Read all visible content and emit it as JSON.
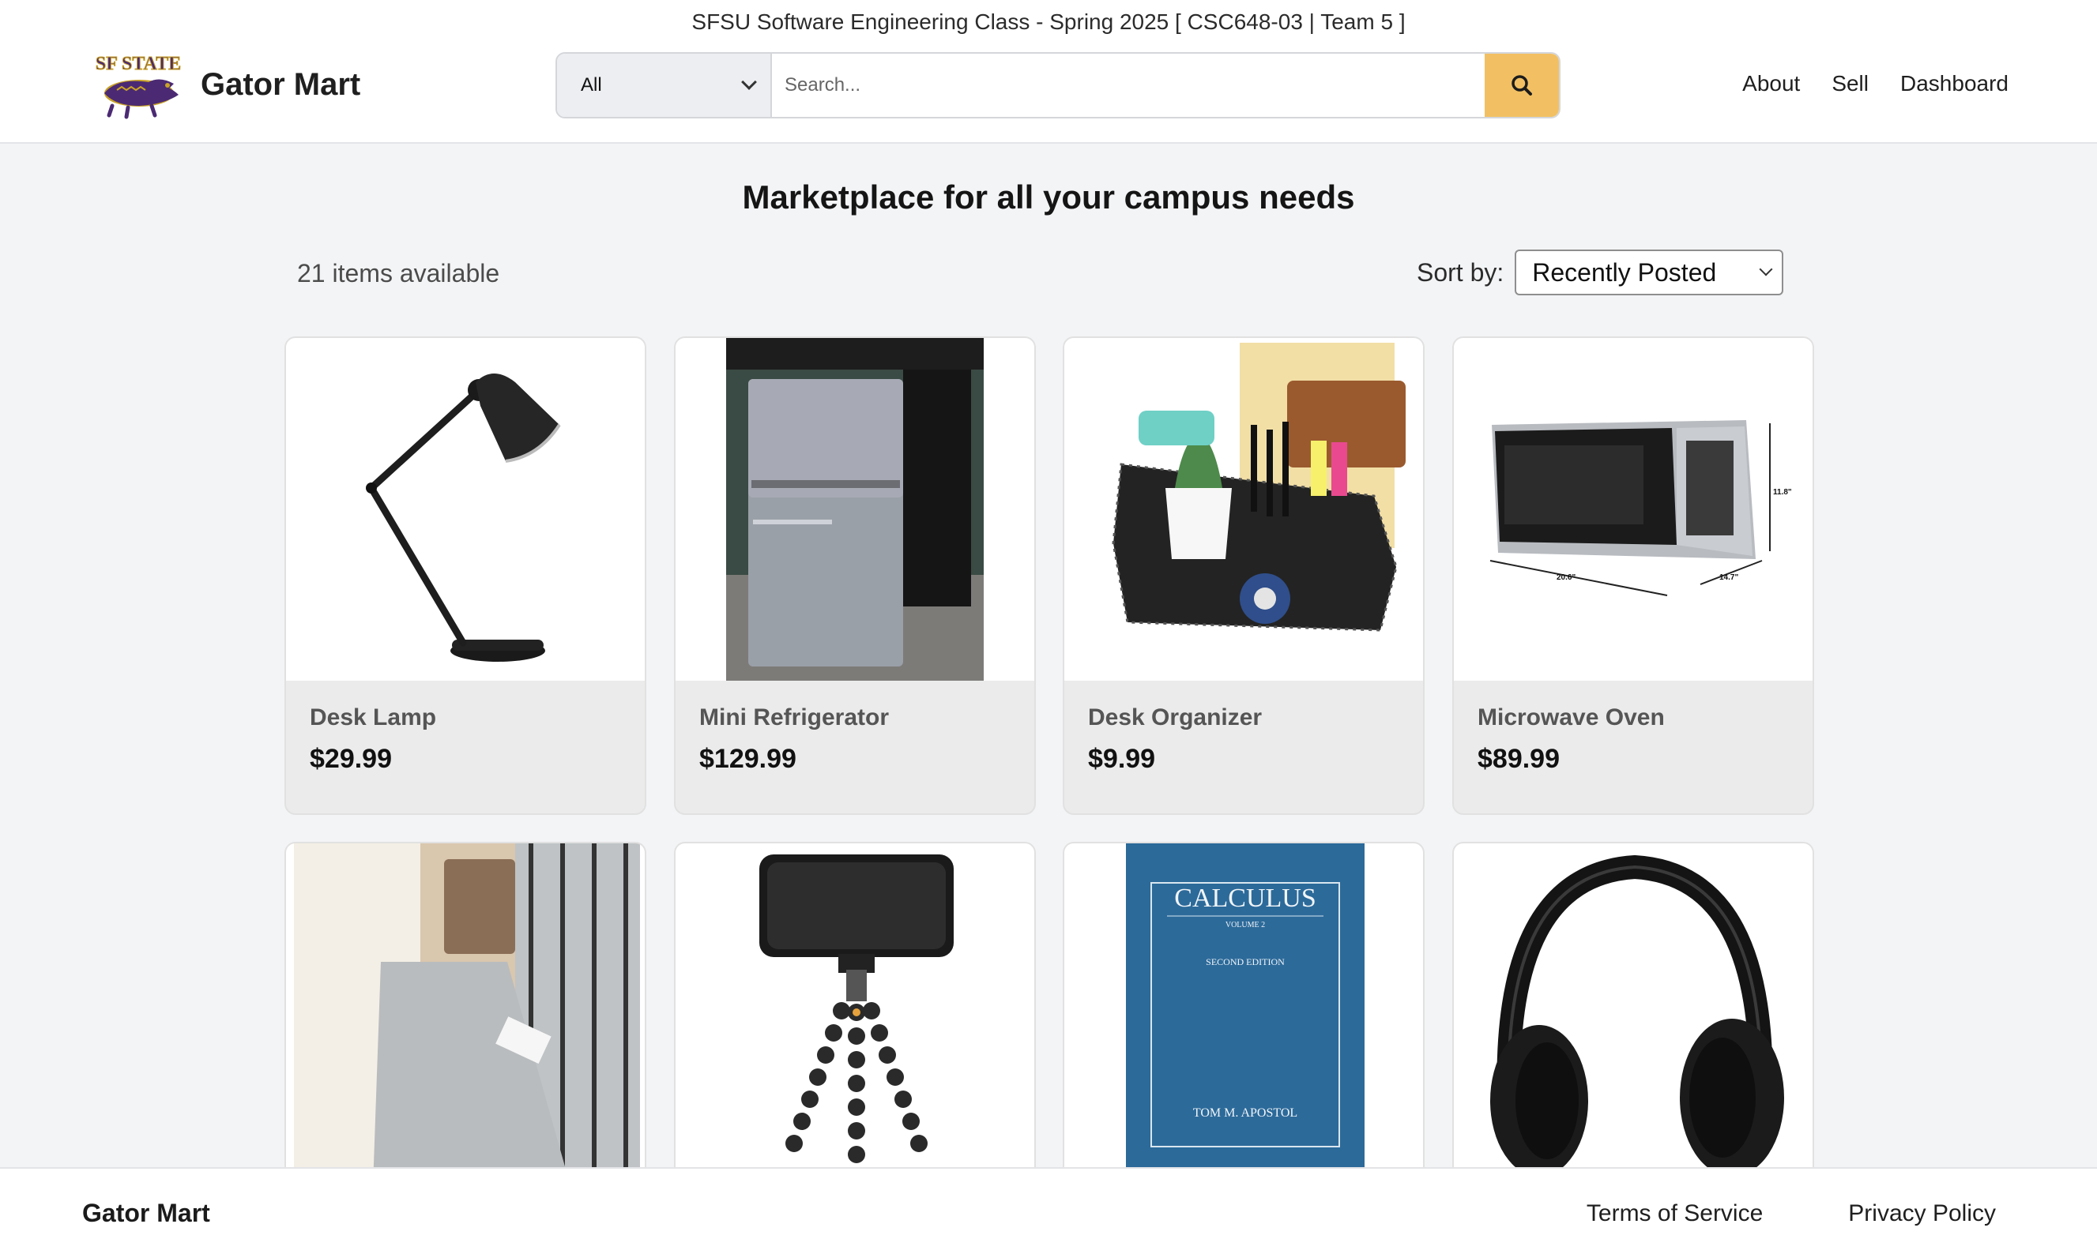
{
  "header": {
    "banner": "SFSU Software Engineering Class - Spring 2025 [ CSC648-03 | Team 5 ]",
    "brand_name": "Gator Mart",
    "logo_text": "SF STATE",
    "search": {
      "category": "All",
      "placeholder": "Search..."
    },
    "nav": [
      "About",
      "Sell",
      "Dashboard"
    ]
  },
  "main": {
    "heading": "Marketplace for all your campus needs",
    "items_count": "21 items available",
    "sort_label": "Sort by:",
    "sort_value": "Recently Posted",
    "products": [
      {
        "name": "Desk Lamp",
        "price": "$29.99"
      },
      {
        "name": "Mini Refrigerator",
        "price": "$129.99"
      },
      {
        "name": "Desk Organizer",
        "price": "$9.99"
      },
      {
        "name": "Microwave Oven",
        "price": "$89.99"
      },
      {
        "name": "",
        "price": ""
      },
      {
        "name": "",
        "price": ""
      },
      {
        "name": "",
        "price": ""
      },
      {
        "name": "",
        "price": ""
      }
    ],
    "book_cover": {
      "title": "CALCULUS",
      "volume": "VOLUME 2",
      "edition": "SECOND EDITION",
      "author": "TOM M. APOSTOL"
    },
    "microwave_dims": {
      "height": "11.8\"",
      "width": "20.6\"",
      "depth": "14.7\""
    }
  },
  "footer": {
    "brand": "Gator Mart",
    "links": [
      "Terms of Service",
      "Privacy Policy"
    ]
  },
  "colors": {
    "accent": "#f2c063",
    "background": "#f3f4f6",
    "card": "#ebebeb",
    "book_blue": "#2c6a9a"
  }
}
